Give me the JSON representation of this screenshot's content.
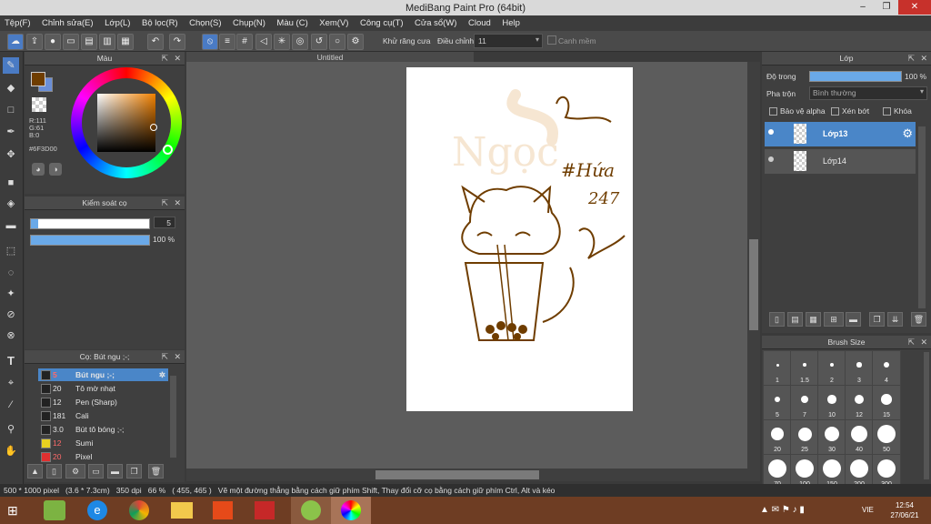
{
  "window": {
    "title": "MediBang Paint Pro (64bit)",
    "minimize": "–",
    "restore": "❐",
    "close": "✕"
  },
  "menu": [
    "Tệp(F)",
    "Chỉnh sửa(E)",
    "Lớp(L)",
    "Bộ lọc(R)",
    "Chọn(S)",
    "Chụp(N)",
    "Màu (C)",
    "Xem(V)",
    "Công cụ(T)",
    "Cửa sổ(W)",
    "Cloud",
    "Help"
  ],
  "toolbar": {
    "antialias_label": "Khử răng cưa",
    "correction_label": "Điều chỉnh",
    "correction_value": "11",
    "snap_label": "Canh mềm"
  },
  "color_panel": {
    "title": "Màu",
    "r": "R:111",
    "g": "G:61",
    "b": "B:0",
    "hex": "#6F3D00",
    "primary_color": "#6F3D00",
    "secondary_color": "#6b8fd8"
  },
  "brush_control": {
    "title": "Kiểm soát cọ",
    "size_value": "5",
    "opacity_value": "100 %",
    "size_fill": 0.05,
    "opacity_fill": 1.0
  },
  "brush_panel": {
    "title": "Cọ: Bút ngu ;-;",
    "items": [
      {
        "size": "5",
        "name": "Bút ngu ;-;",
        "color": "#222222"
      },
      {
        "size": "20",
        "name": "Tô mờ nhạt",
        "color": "#222222"
      },
      {
        "size": "12",
        "name": "Pen (Sharp)",
        "color": "#222222"
      },
      {
        "size": "181",
        "name": "Cali",
        "color": "#222222"
      },
      {
        "size": "3.0",
        "name": "Bút tô bóng ;-;",
        "color": "#222222"
      },
      {
        "size": "12",
        "name": "Sumi",
        "color": "#e8d020"
      },
      {
        "size": "20",
        "name": "Pixel",
        "color": "#e03030"
      }
    ]
  },
  "canvas": {
    "tab_title": "Untitled"
  },
  "artwork": {
    "watermark_text": "Ngọc",
    "signature_line1": "#Hứa",
    "signature_line2": "247"
  },
  "layer_panel": {
    "title": "Lớp",
    "opacity_label": "Độ trong",
    "opacity_value": "100 %",
    "blend_label": "Pha trộn",
    "blend_value": "Bình thường",
    "protect_alpha": "Bảo vệ alpha",
    "clipping": "Xén bớt",
    "lock": "Khóa",
    "layers": [
      {
        "name": "Lớp13",
        "selected": true
      },
      {
        "name": "Lớp14",
        "selected": false
      }
    ]
  },
  "brush_size_panel": {
    "title": "Brush Size",
    "sizes": [
      "1",
      "1.5",
      "2",
      "3",
      "4",
      "5",
      "7",
      "10",
      "12",
      "15",
      "20",
      "25",
      "30",
      "40",
      "50",
      "70",
      "100",
      "150",
      "200",
      "300"
    ]
  },
  "status": {
    "text": "500 * 1000 pixel   (3.6 * 7.3cm)   350 dpi   66 %   ( 455, 465 )   Vẽ một đường thẳng bằng cách giữ phím Shift, Thay đổi cỡ cọ bằng cách giữ phím Ctrl, Alt và kéo"
  },
  "taskbar": {
    "lang": "VIE",
    "time": "12:54",
    "date": "27/06/21"
  }
}
